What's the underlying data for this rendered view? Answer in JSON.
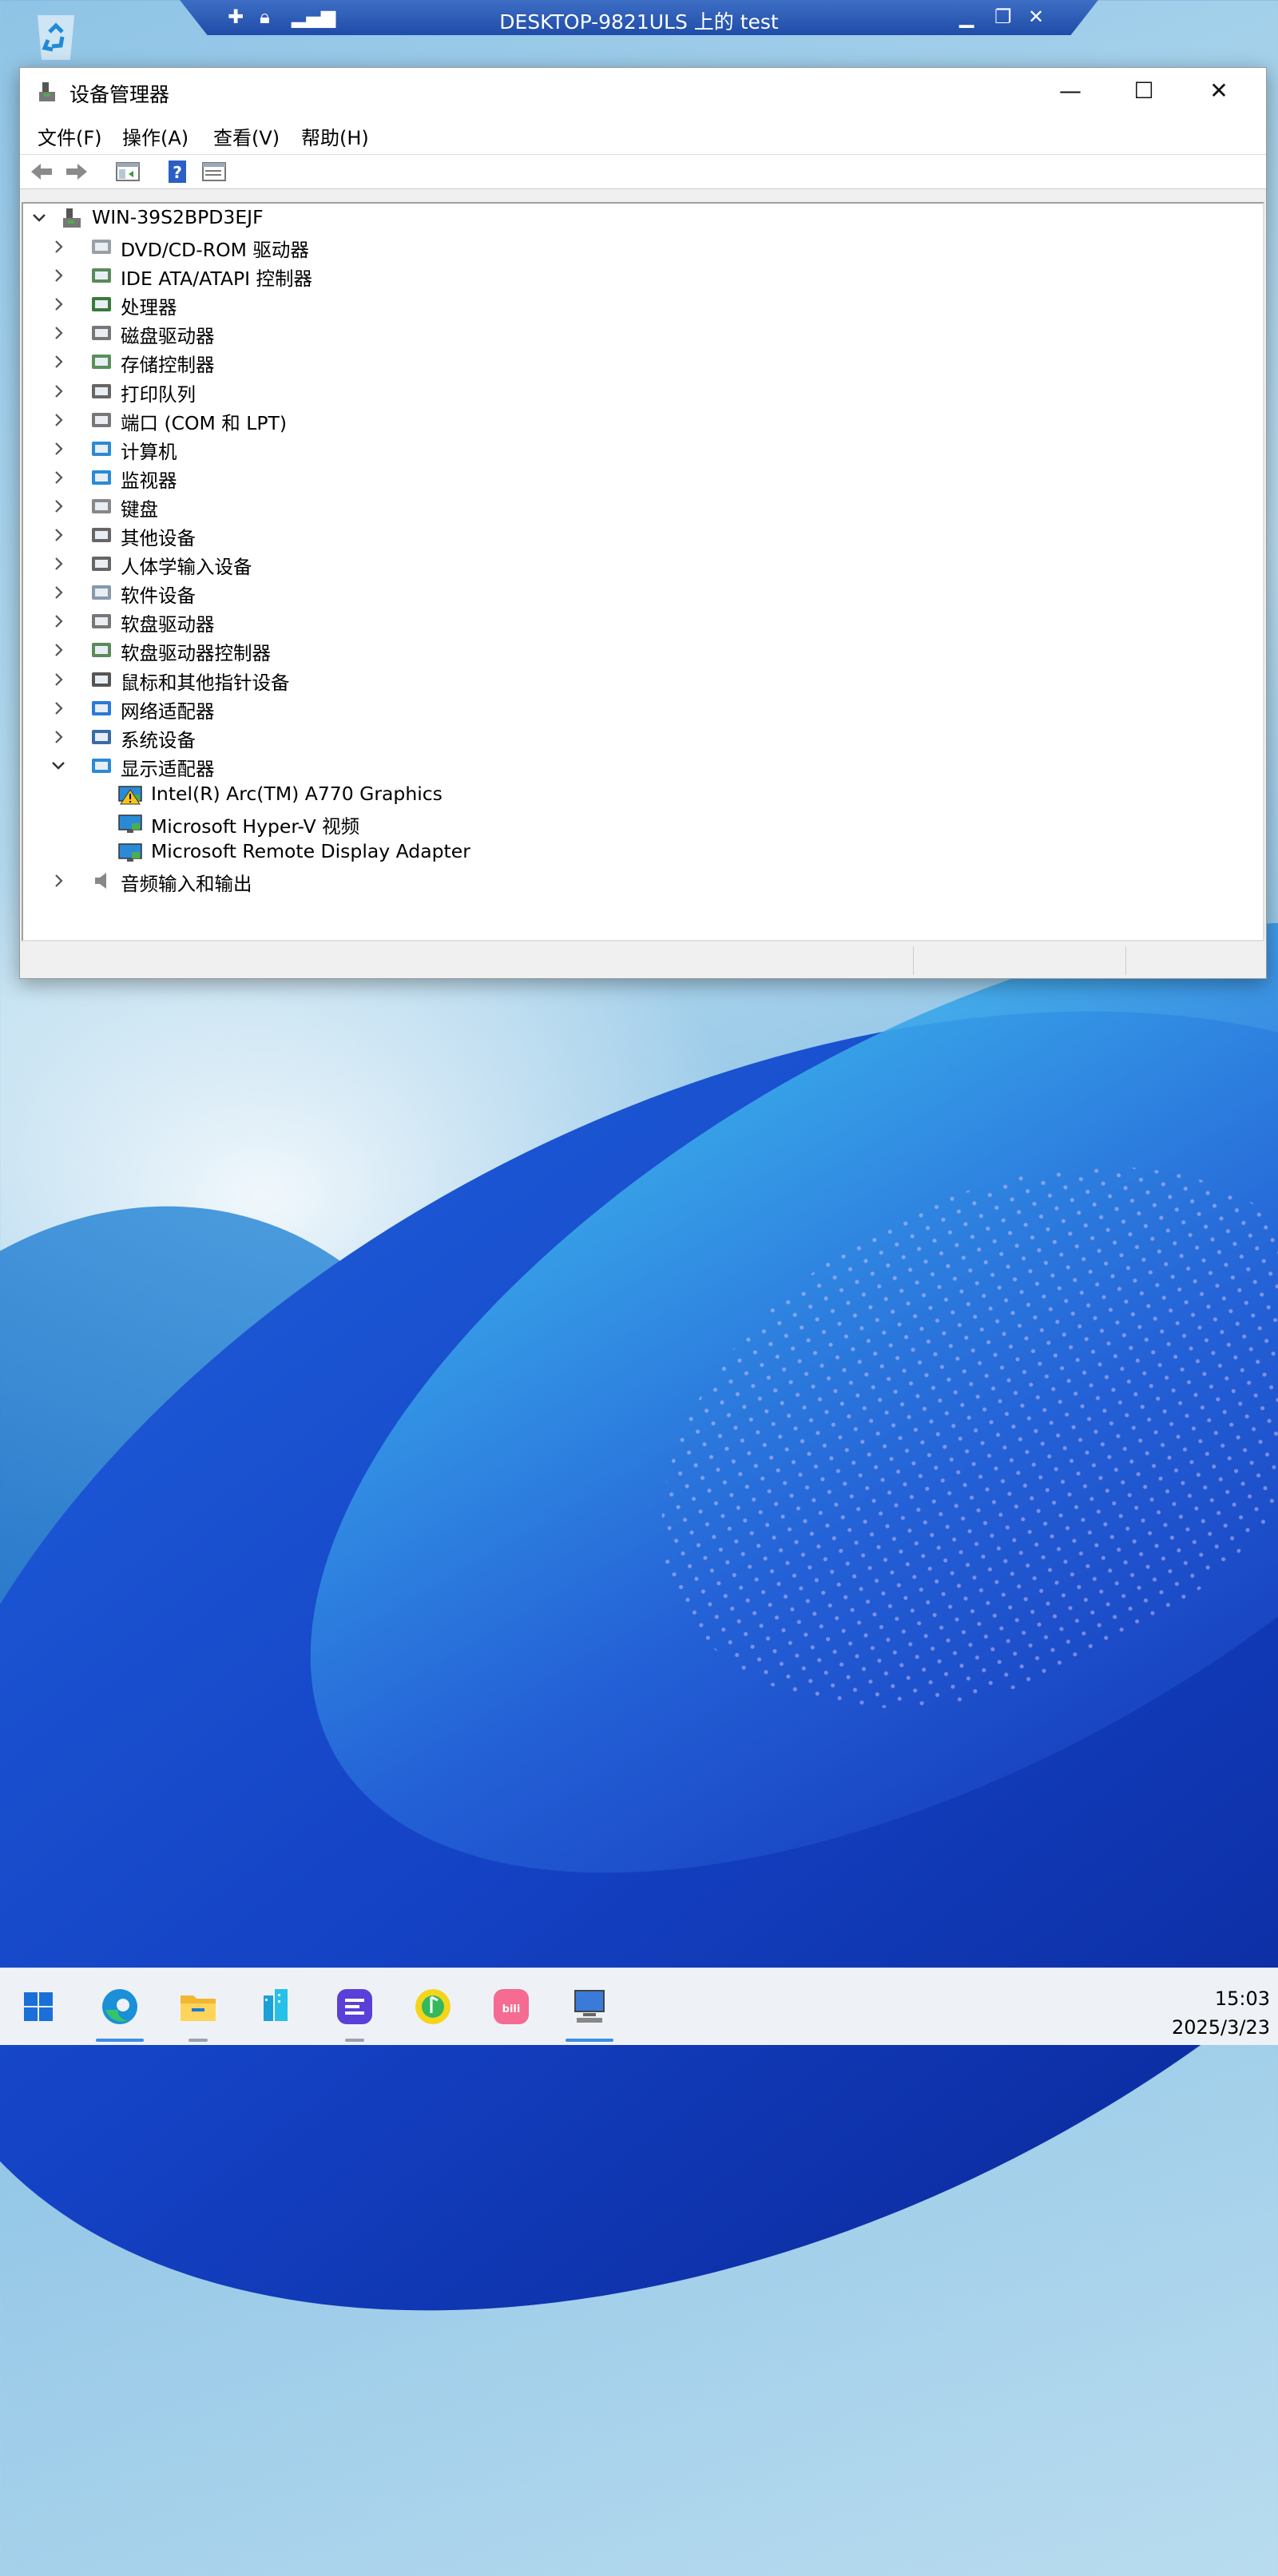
{
  "rdp_bar": {
    "title": "DESKTOP-9821ULS 上的 test"
  },
  "window": {
    "title": "设备管理器",
    "menu": [
      "文件(F)",
      "操作(A)",
      "查看(V)",
      "帮助(H)"
    ],
    "root": "WIN-39S2BPD3EJF",
    "categories": [
      {
        "label": "DVD/CD-ROM 驱动器",
        "icon": "dvd-drive-icon"
      },
      {
        "label": "IDE ATA/ATAPI 控制器",
        "icon": "ide-controller-icon"
      },
      {
        "label": "处理器",
        "icon": "processor-icon"
      },
      {
        "label": "磁盘驱动器",
        "icon": "disk-drive-icon"
      },
      {
        "label": "存储控制器",
        "icon": "storage-controller-icon"
      },
      {
        "label": "打印队列",
        "icon": "printer-icon"
      },
      {
        "label": "端口 (COM 和 LPT)",
        "icon": "port-icon"
      },
      {
        "label": "计算机",
        "icon": "computer-icon"
      },
      {
        "label": "监视器",
        "icon": "monitor-icon"
      },
      {
        "label": "键盘",
        "icon": "keyboard-icon"
      },
      {
        "label": "其他设备",
        "icon": "other-devices-icon"
      },
      {
        "label": "人体学输入设备",
        "icon": "hid-icon"
      },
      {
        "label": "软件设备",
        "icon": "software-device-icon"
      },
      {
        "label": "软盘驱动器",
        "icon": "floppy-drive-icon"
      },
      {
        "label": "软盘驱动器控制器",
        "icon": "floppy-controller-icon"
      },
      {
        "label": "鼠标和其他指针设备",
        "icon": "mouse-icon"
      },
      {
        "label": "网络适配器",
        "icon": "network-adapter-icon"
      },
      {
        "label": "系统设备",
        "icon": "system-device-icon"
      }
    ],
    "display_adapters": {
      "label": "显示适配器",
      "children": [
        {
          "label": "Intel(R) Arc(TM) A770 Graphics",
          "warning": true
        },
        {
          "label": "Microsoft Hyper-V 视频",
          "warning": false
        },
        {
          "label": "Microsoft Remote Display Adapter",
          "warning": false
        }
      ]
    },
    "audio": {
      "label": "音频输入和输出"
    }
  },
  "taskbar": {
    "apps": [
      "start-icon",
      "edge-icon",
      "file-explorer-icon",
      "app-icon",
      "notes-app-icon",
      "music-app-icon",
      "bilibili-icon",
      "remote-desktop-icon"
    ],
    "time": "15:03",
    "date": "2025/3/23"
  },
  "colors": {
    "accent": "#3c8de8",
    "rdp_bar": "#2a5bb8"
  }
}
